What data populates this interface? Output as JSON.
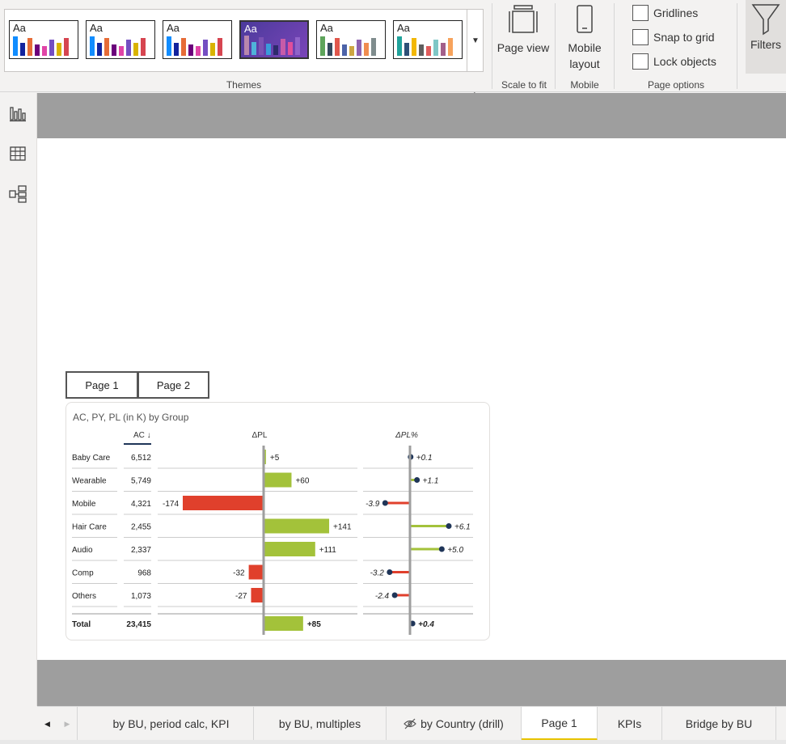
{
  "ribbon": {
    "themes_label": "Themes",
    "theme_glyph": "Aa",
    "themes": [
      {
        "name": "theme-1",
        "selected": false,
        "bars": [
          "#118dff",
          "#12239e",
          "#e66c37",
          "#6b007b",
          "#e044a7",
          "#744ec2",
          "#d9b300",
          "#d64550"
        ]
      },
      {
        "name": "theme-2",
        "selected": false,
        "bars": [
          "#118dff",
          "#12239e",
          "#e66c37",
          "#6b007b",
          "#e044a7",
          "#744ec2",
          "#d9b300",
          "#d64550"
        ]
      },
      {
        "name": "theme-3",
        "selected": false,
        "bars": [
          "#118dff",
          "#12239e",
          "#e66c37",
          "#6b007b",
          "#e044a7",
          "#744ec2",
          "#d9b300",
          "#d64550"
        ]
      },
      {
        "name": "theme-4",
        "selected": true,
        "bars": [
          "#b887ad",
          "#4fb3d9",
          "#7a52b3",
          "#3a9bd9",
          "#2d2a6b",
          "#c75ba8",
          "#e04f9a",
          "#8f63c9"
        ]
      },
      {
        "name": "theme-5",
        "selected": false,
        "bars": [
          "#5ea45b",
          "#34495e",
          "#e0574c",
          "#4c63a8",
          "#cda642",
          "#8e63b0",
          "#f08d4f",
          "#7f8c8d"
        ]
      },
      {
        "name": "theme-6",
        "selected": false,
        "bars": [
          "#21a39c",
          "#2e5077",
          "#f2b705",
          "#5f5f5f",
          "#e05c5c",
          "#7fc7c6",
          "#a35f8a",
          "#f7a35c"
        ]
      }
    ],
    "page_view_label": "Page view",
    "scale_to_fit_label": "Scale to fit",
    "mobile_layout_label": "Mobile layout",
    "mobile_label": "Mobile",
    "page_options_label": "Page options",
    "gridlines_label": "Gridlines",
    "snap_label": "Snap to grid",
    "lock_label": "Lock objects",
    "filters_label": "Filters"
  },
  "page_buttons": {
    "page1": "Page 1",
    "page2": "Page 2"
  },
  "chart_data": {
    "type": "table",
    "title": "AC, PY, PL (in K) by Group",
    "column_headers": {
      "ac": "AC ↓",
      "dpl": "ΔPL",
      "dplpct": "ΔPL%"
    },
    "rows": [
      {
        "group": "Baby Care",
        "ac": "6,512",
        "dpl": 5,
        "dpl_label": "+5",
        "dplpct": 0.1,
        "dplpct_label": "+0.1"
      },
      {
        "group": "Wearable",
        "ac": "5,749",
        "dpl": 60,
        "dpl_label": "+60",
        "dplpct": 1.1,
        "dplpct_label": "+1.1"
      },
      {
        "group": "Mobile",
        "ac": "4,321",
        "dpl": -174,
        "dpl_label": "-174",
        "dplpct": -3.9,
        "dplpct_label": "-3.9"
      },
      {
        "group": "Hair Care",
        "ac": "2,455",
        "dpl": 141,
        "dpl_label": "+141",
        "dplpct": 6.1,
        "dplpct_label": "+6.1"
      },
      {
        "group": "Audio",
        "ac": "2,337",
        "dpl": 111,
        "dpl_label": "+111",
        "dplpct": 5.0,
        "dplpct_label": "+5.0"
      },
      {
        "group": "Comp",
        "ac": "968",
        "dpl": -32,
        "dpl_label": "-32",
        "dplpct": -3.2,
        "dplpct_label": "-3.2"
      },
      {
        "group": "Others",
        "ac": "1,073",
        "dpl": -27,
        "dpl_label": "-27",
        "dplpct": -2.4,
        "dplpct_label": "-2.4"
      }
    ],
    "total": {
      "group": "Total",
      "ac": "23,415",
      "dpl": 85,
      "dpl_label": "+85",
      "dplpct": 0.4,
      "dplpct_label": "+0.4"
    },
    "colors": {
      "positive": "#a3c23a",
      "negative": "#e0402c",
      "axis": "#9e9e9e",
      "dot": "#1f3558"
    }
  },
  "tabs": [
    {
      "label": "by BU, period calc, KPI",
      "active": false,
      "hidden": false
    },
    {
      "label": "by BU, multiples",
      "active": false,
      "hidden": false
    },
    {
      "label": "by Country (drill)",
      "active": false,
      "hidden": true
    },
    {
      "label": "Page 1",
      "active": true,
      "hidden": false
    },
    {
      "label": "KPIs",
      "active": false,
      "hidden": false
    },
    {
      "label": "Bridge by BU",
      "active": false,
      "hidden": false
    }
  ]
}
